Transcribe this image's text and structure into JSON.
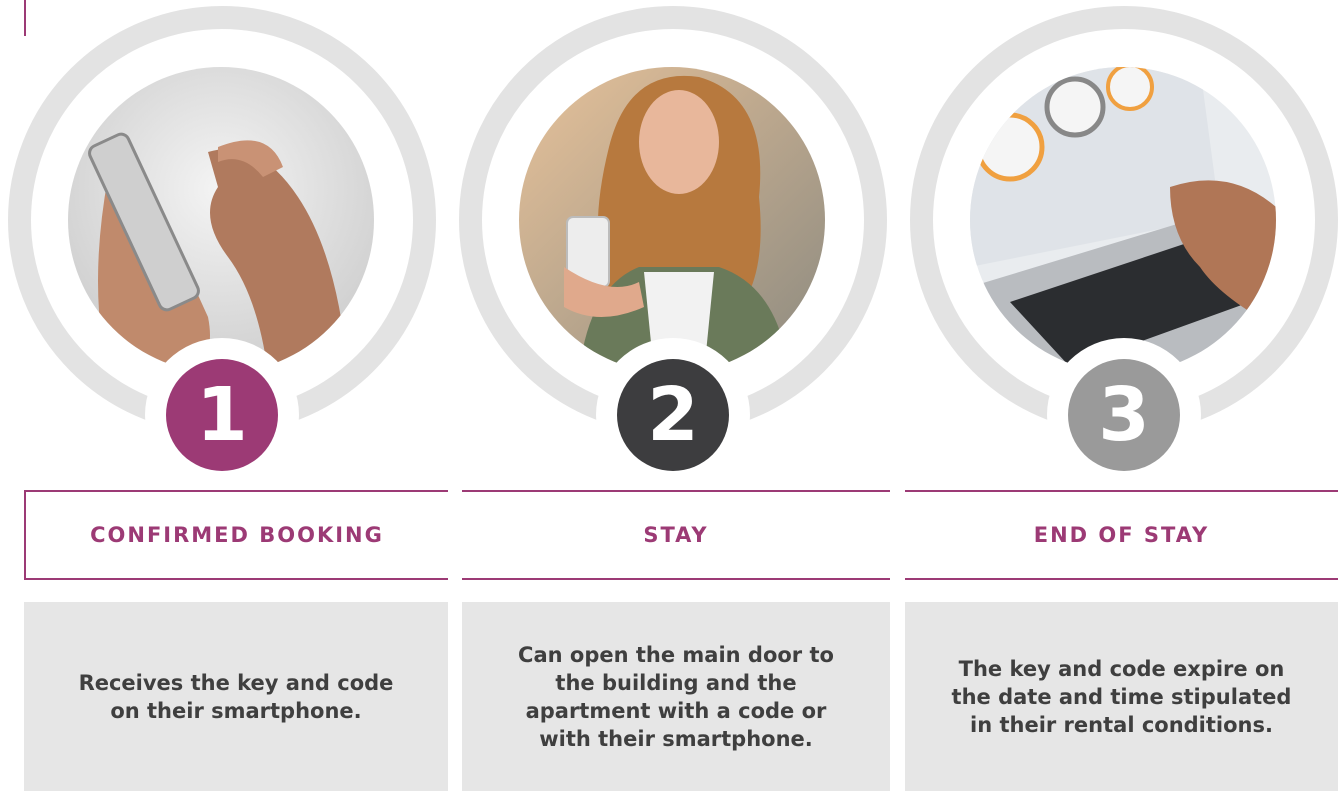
{
  "colors": {
    "accent": "#9c3a75",
    "dark": "#3d3d3f",
    "grey": "#9a9a9a",
    "ring": "#e3e3e3",
    "panel": "#e6e6e6",
    "text": "#3f3f3f"
  },
  "steps": [
    {
      "number": "1",
      "title": "CONFIRMED BOOKING",
      "description": "Receives the key and code on their smartphone.",
      "image": "hands-holding-smartphone-photo"
    },
    {
      "number": "2",
      "title": "STAY",
      "description": "Can open the main door to the building and the apartment with a code or with their smartphone.",
      "image": "smiling-woman-with-smartphone-photo"
    },
    {
      "number": "3",
      "title": "END OF STAY",
      "description": "The key and code expire on the date and time stipulated in their rental conditions.",
      "image": "laptop-with-clocks-photo"
    }
  ]
}
